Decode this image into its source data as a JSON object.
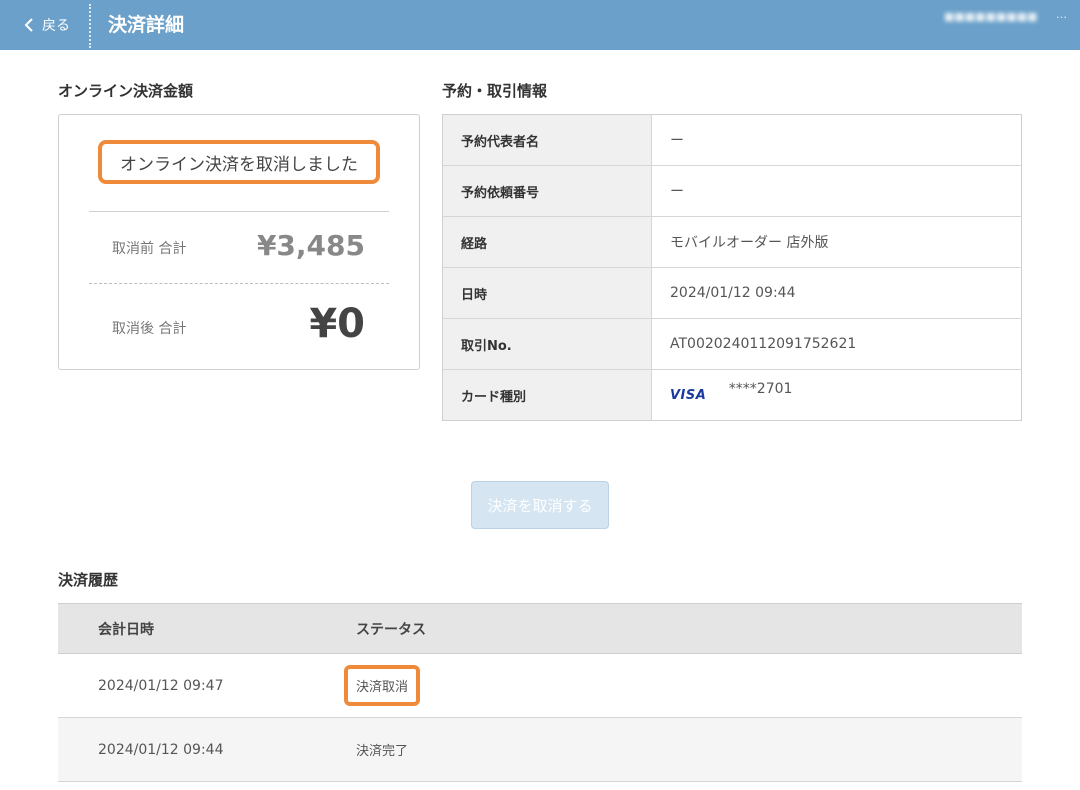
{
  "header": {
    "back_label": "戻る",
    "title": "決済詳細",
    "account": "■■■■■■■■■",
    "more": "…"
  },
  "amount": {
    "section_title": "オンライン決済金額",
    "cancel_notice": "オンライン決済を取消しました",
    "before_label": "取消前 合計",
    "before_value": "¥3,485",
    "after_label": "取消後 合計",
    "after_value": "¥0"
  },
  "info": {
    "section_title": "予約・取引情報",
    "rows": [
      {
        "label": "予約代表者名",
        "value": "ー"
      },
      {
        "label": "予約依頼番号",
        "value": "ー"
      },
      {
        "label": "経路",
        "value": "モバイルオーダー 店外版"
      },
      {
        "label": "日時",
        "value": "2024/01/12 09:44"
      },
      {
        "label": "取引No.",
        "value": "AT0020240112091752621"
      },
      {
        "label": "カード種別",
        "brand": "VISA",
        "value": "****2701"
      }
    ]
  },
  "cancel_button": {
    "label": "決済を取消する",
    "disabled": true
  },
  "history": {
    "section_title": "決済履歴",
    "columns": [
      "会計日時",
      "ステータス"
    ],
    "rows": [
      {
        "datetime": "2024/01/12 09:47",
        "status": "決済取消"
      },
      {
        "datetime": "2024/01/12 09:44",
        "status": "決済完了"
      }
    ]
  },
  "colors": {
    "header_bg": "#6aa0c9",
    "highlight": "#ee8a3a",
    "visa": "#1a3aa0",
    "disabled_button": "#d6e5f2"
  }
}
